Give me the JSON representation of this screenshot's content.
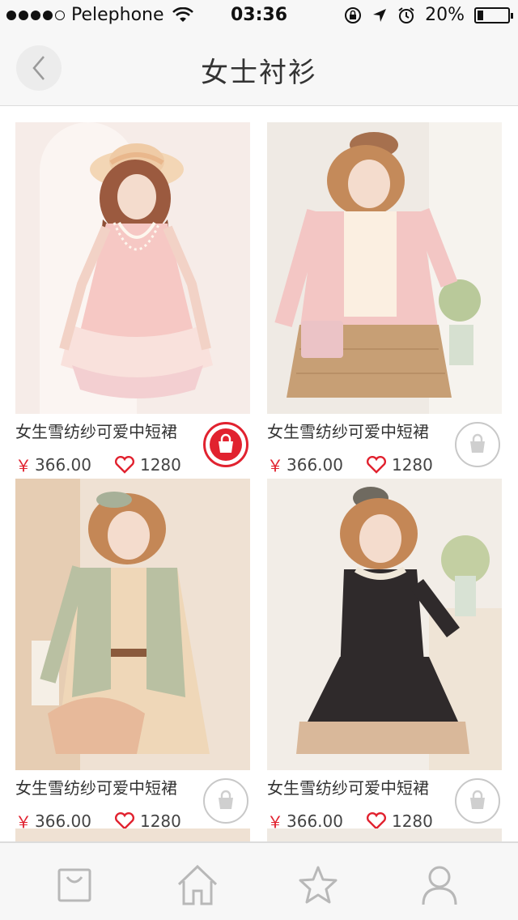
{
  "status_bar": {
    "carrier": "Pelephone",
    "time": "03:36",
    "battery": "20%",
    "battery_level": 0.2,
    "signal_bars_filled": 4,
    "signal_bars_total": 5,
    "icons": [
      "wifi-icon",
      "rotation-lock-icon",
      "location-arrow-icon",
      "alarm-icon",
      "battery-icon"
    ]
  },
  "navbar": {
    "title": "女士衬衫",
    "back_icon": "chevron-left-icon"
  },
  "products": [
    {
      "name": "女生雪纺纱可爱中短裙",
      "currency": "￥",
      "price": "366.00",
      "likes": "1280",
      "in_bag": true
    },
    {
      "name": "女生雪纺纱可爱中短裙",
      "currency": "￥",
      "price": "366.00",
      "likes": "1280",
      "in_bag": false
    },
    {
      "name": "女生雪纺纱可爱中短裙",
      "currency": "￥",
      "price": "366.00",
      "likes": "1280",
      "in_bag": false
    },
    {
      "name": "女生雪纺纱可爱中短裙",
      "currency": "￥",
      "price": "366.00",
      "likes": "1280",
      "in_bag": false
    }
  ],
  "tab_bar": {
    "tabs": [
      {
        "icon": "shopping-bag-icon"
      },
      {
        "icon": "home-icon"
      },
      {
        "icon": "star-icon"
      },
      {
        "icon": "user-icon"
      }
    ]
  },
  "colors": {
    "accent": "#e1222f",
    "inactive_icon": "#c8c8c8",
    "bar_background": "#f7f7f7"
  }
}
